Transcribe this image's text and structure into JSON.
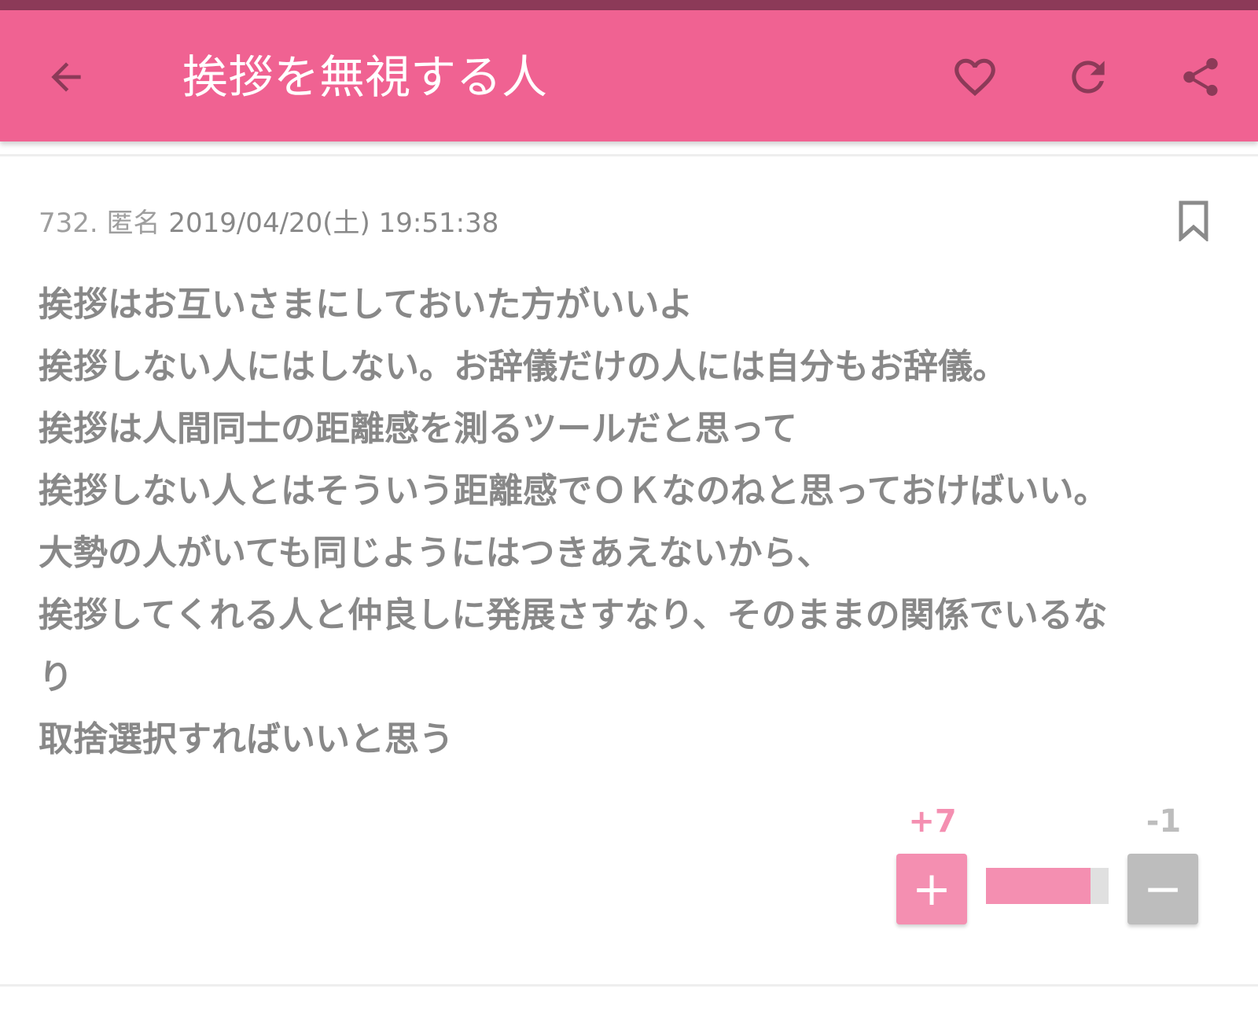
{
  "header": {
    "title": "挨拶を無視する人",
    "icons": {
      "back": "arrow-left-icon",
      "favorite": "heart-icon",
      "reload": "refresh-icon",
      "share": "share-icon"
    }
  },
  "post": {
    "number": "732.",
    "author": "匿名",
    "datetime": "2019/04/20(土) 19:51:38",
    "bookmark_icon": "bookmark-icon",
    "lines": [
      "挨拶はお互いさまにしておいた方がいいよ",
      "挨拶しない人にはしない。お辞儀だけの人には自分もお辞儀。",
      "挨拶は人間同士の距離感を測るツールだと思って",
      "挨拶しない人とはそういう距離感でＯＫなのねと思っておけばいい。",
      "大勢の人がいても同じようにはつきあえないから、",
      "挨拶してくれる人と仲良しに発展さすなり、そのままの関係でいるな",
      "り",
      "取捨選択すればいいと思う"
    ]
  },
  "votes": {
    "plus_count": "+7",
    "minus_count": "-1",
    "plus_label": "+",
    "minus_label": "−",
    "plus_ratio": 0.85
  },
  "colors": {
    "app_bar": "#f06292",
    "status_strip": "#8c3a58",
    "plus": "#f48fb1",
    "minus": "#bdbdbd",
    "text": "#888888"
  }
}
